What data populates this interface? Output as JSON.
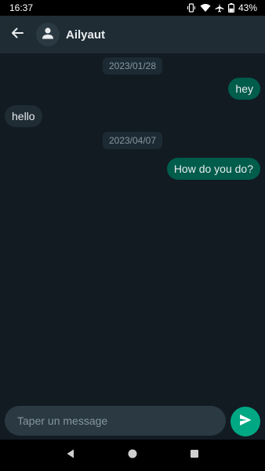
{
  "status_bar": {
    "time": "16:37",
    "battery": "43%",
    "icons": [
      "vibrate-icon",
      "wifi-icon",
      "airplane-icon",
      "battery-icon"
    ]
  },
  "header": {
    "contact_name": "Ailyaut",
    "back_icon": "arrow-left-icon",
    "avatar_icon": "person-icon"
  },
  "messages": [
    {
      "type": "date",
      "text": "2023/01/28"
    },
    {
      "type": "outgoing",
      "text": "hey"
    },
    {
      "type": "incoming",
      "text": "hello"
    },
    {
      "type": "date",
      "text": "2023/04/07"
    },
    {
      "type": "outgoing",
      "text": "How do you do?"
    }
  ],
  "composer": {
    "placeholder": "Taper un message",
    "send_icon": "send-icon"
  },
  "navigation": {
    "icons": [
      "back-triangle-icon",
      "home-circle-icon",
      "recents-square-icon"
    ]
  },
  "colors": {
    "background": "#121b22",
    "app_bar": "#1f2c34",
    "outgoing_bubble": "#005c4b",
    "incoming_bubble": "#1f2c34",
    "accent": "#00a884"
  }
}
